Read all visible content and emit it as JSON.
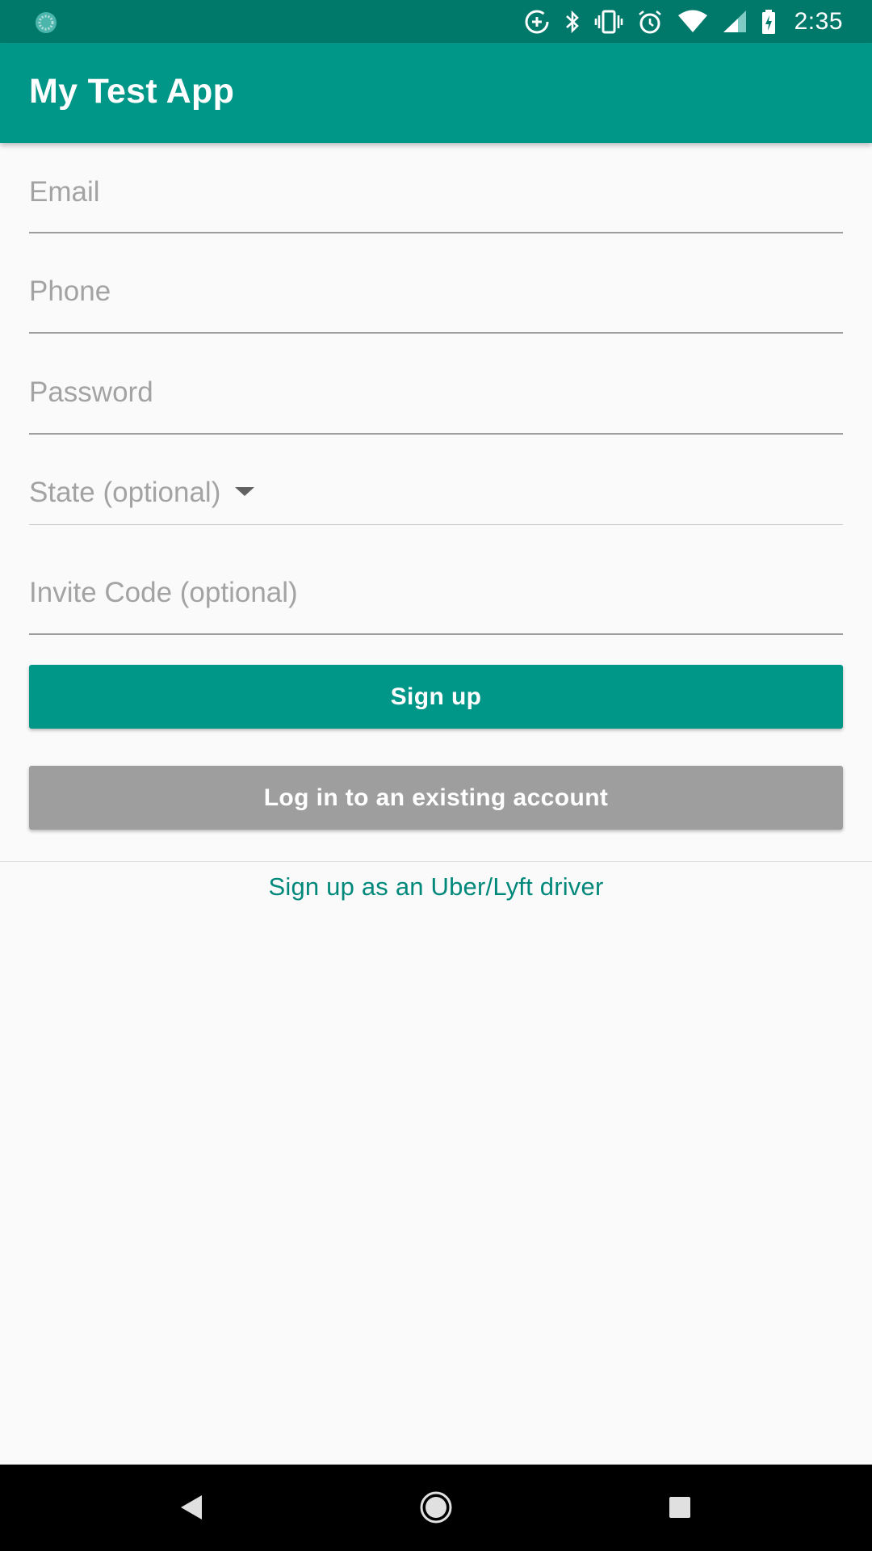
{
  "status_bar": {
    "time": "2:35",
    "icons": [
      "app-notification-icon",
      "data-saver-icon",
      "bluetooth-icon",
      "vibrate-icon",
      "alarm-icon",
      "wifi-icon",
      "cell-signal-icon",
      "battery-charging-icon"
    ]
  },
  "app_bar": {
    "title": "My Test App"
  },
  "form": {
    "email_placeholder": "Email",
    "phone_placeholder": "Phone",
    "password_placeholder": "Password",
    "state_placeholder": "State (optional)",
    "invite_placeholder": "Invite Code (optional)"
  },
  "buttons": {
    "signup_label": "Sign up",
    "login_label": "Log in to an existing account"
  },
  "driver_link": "Sign up as an Uber/Lyft driver",
  "nav_bar": {
    "icons": [
      "back-icon",
      "home-icon",
      "recents-icon"
    ]
  },
  "colors": {
    "status_bar": "#00796b",
    "app_bar": "#009688",
    "primary_button": "#009688",
    "secondary_button": "#9e9e9e",
    "link": "#00897b"
  }
}
